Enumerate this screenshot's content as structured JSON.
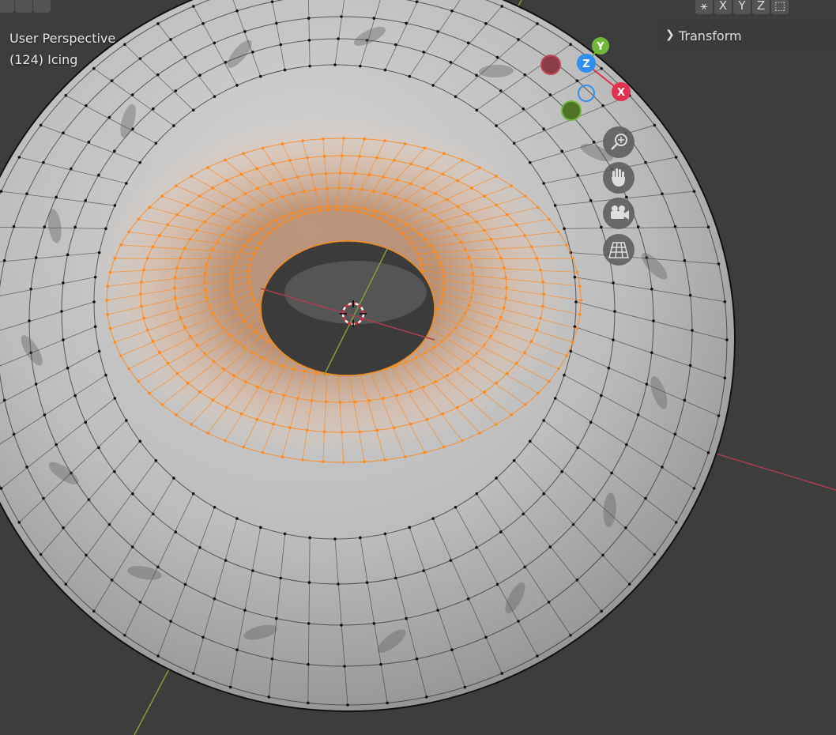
{
  "viewport": {
    "view_name": "User Perspective",
    "object_label": "(124) Icing"
  },
  "header": {
    "axis_toggles": [
      "X",
      "Y",
      "Z"
    ]
  },
  "sidebar": {
    "transform_label": "Transform"
  },
  "gizmo": {
    "x_label": "X",
    "y_label": "Y",
    "z_label": "Z",
    "colors": {
      "x": "#e0314f",
      "y": "#71b83a",
      "z": "#2e8ff0",
      "selection": "#ff8a1a"
    }
  },
  "nav_icons": [
    "zoom-icon",
    "pan-hand-icon",
    "camera-icon",
    "perspective-grid-icon"
  ]
}
